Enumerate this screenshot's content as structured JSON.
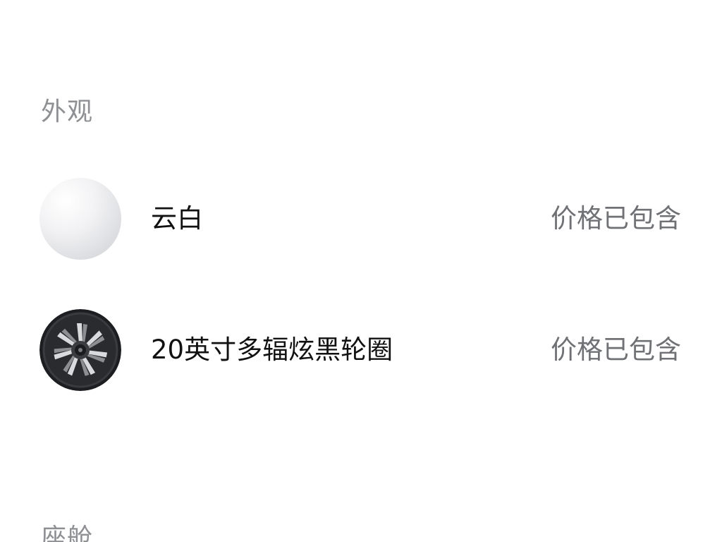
{
  "sections": {
    "exterior": {
      "title": "外观",
      "options": [
        {
          "name": "云白",
          "price_status": "价格已包含",
          "swatch_icon": "white-paint-swatch",
          "swatch_color": "#e6e7e9"
        },
        {
          "name": "20英寸多辐炫黑轮圈",
          "price_status": "价格已包含",
          "swatch_icon": "wheel-rim-thumbnail"
        }
      ]
    },
    "seats": {
      "title": "座舱"
    }
  }
}
